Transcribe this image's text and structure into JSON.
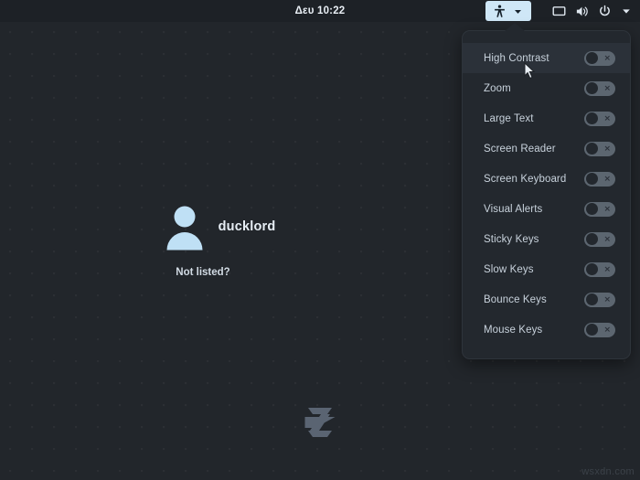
{
  "topbar": {
    "clock": "Δευ 10:22",
    "accessibility_button": {
      "icon": "accessibility-icon",
      "dropdown_icon": "chevron-down-icon",
      "active": true
    },
    "tray_icons": [
      {
        "name": "display-icon",
        "label": "Display"
      },
      {
        "name": "volume-icon",
        "label": "Volume"
      },
      {
        "name": "power-icon",
        "label": "Power"
      },
      {
        "name": "chevron-down-icon",
        "label": "System menu"
      }
    ]
  },
  "accessibility_menu": {
    "items": [
      {
        "label": "High Contrast",
        "enabled": false,
        "hovered": true
      },
      {
        "label": "Zoom",
        "enabled": false,
        "hovered": false
      },
      {
        "label": "Large Text",
        "enabled": false,
        "hovered": false
      },
      {
        "label": "Screen Reader",
        "enabled": false,
        "hovered": false
      },
      {
        "label": "Screen Keyboard",
        "enabled": false,
        "hovered": false
      },
      {
        "label": "Visual Alerts",
        "enabled": false,
        "hovered": false
      },
      {
        "label": "Sticky Keys",
        "enabled": false,
        "hovered": false
      },
      {
        "label": "Slow Keys",
        "enabled": false,
        "hovered": false
      },
      {
        "label": "Bounce Keys",
        "enabled": false,
        "hovered": false
      },
      {
        "label": "Mouse Keys",
        "enabled": false,
        "hovered": false
      }
    ],
    "toggle_off_glyph": "×"
  },
  "login": {
    "username": "ducklord",
    "not_listed_label": "Not listed?",
    "avatar_icon": "user-avatar-icon"
  },
  "branding": {
    "logo_icon": "zorin-logo-icon"
  },
  "watermark": {
    "text": "wsxdn.com"
  },
  "colors": {
    "background": "#22262b",
    "topbar": "#1d2126",
    "panel": "#23282e",
    "panel_hover": "#2b3139",
    "accent_highlight": "#cfe7f7",
    "avatar": "#bfe0f5",
    "text_primary": "#e7eef5",
    "text_secondary": "#c8d2dc",
    "switch_off": "#5c6670",
    "logo": "#5a6472"
  }
}
